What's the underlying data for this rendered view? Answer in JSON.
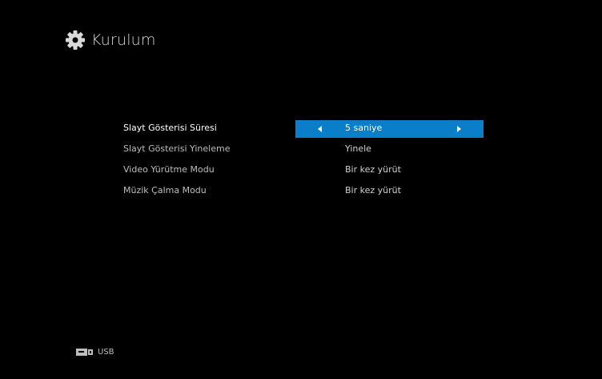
{
  "header": {
    "title": "Kurulum",
    "icon": "gear-icon"
  },
  "settings": [
    {
      "label": "Slayt Gösterisi Süresi",
      "value": "5 saniye",
      "selected": true
    },
    {
      "label": "Slayt Gösterisi Yineleme",
      "value": "Yinele",
      "selected": false
    },
    {
      "label": "Video Yürütme Modu",
      "value": "Bir kez yürüt",
      "selected": false
    },
    {
      "label": "Müzik Çalma Modu",
      "value": "Bir kez yürüt",
      "selected": false
    }
  ],
  "footer": {
    "source_label": "USB",
    "source_icon": "usb-icon"
  },
  "colors": {
    "background": "#000000",
    "highlight": "#0a7ec8",
    "text": "#bdbdbd",
    "text_active": "#ffffff"
  }
}
